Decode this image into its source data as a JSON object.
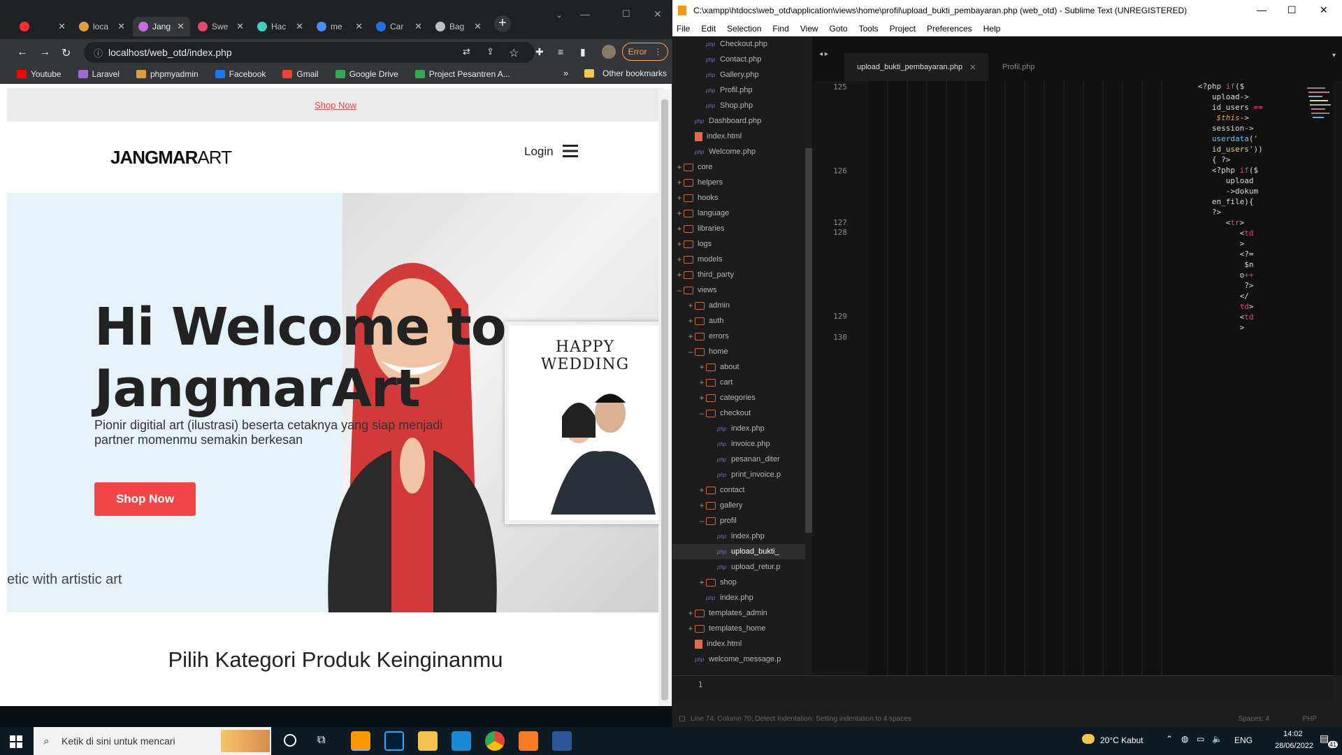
{
  "browser": {
    "tabs": [
      {
        "label": "",
        "color": "#ff2d2d"
      },
      {
        "label": "loca",
        "color": "#e09c3c"
      },
      {
        "label": "Jang",
        "color": "#c76ee0"
      },
      {
        "label": "Swe",
        "color": "#e44a6c"
      },
      {
        "label": "Hac",
        "color": "#3fd0c2"
      },
      {
        "label": "me",
        "color": "#4a8af4"
      },
      {
        "label": "Car",
        "color": "#1a73e8"
      },
      {
        "label": "Bag",
        "color": "#bdc1c6"
      }
    ],
    "url": "localhost/web_otd/index.php",
    "error_label": "Error",
    "bookmarks": [
      {
        "label": "Youtube",
        "color": "#ff0000"
      },
      {
        "label": "Laravel",
        "color": "#9b6bd6"
      },
      {
        "label": "phpmyadmin",
        "color": "#e09c3c"
      },
      {
        "label": "Facebook",
        "color": "#1877f2"
      },
      {
        "label": "Gmail",
        "color": "#ea4335"
      },
      {
        "label": "Google Drive",
        "color": "#34a853"
      },
      {
        "label": "Project Pesantren A...",
        "color": "#34a853"
      }
    ],
    "other_bookmarks": "Other bookmarks"
  },
  "site": {
    "top_link": "Shop Now",
    "logo_bold": "JANGMAR",
    "logo_light": "ART",
    "login": "Login",
    "hero_title": "Hi Welcome to JangmarArt",
    "hero_sub": "Pionir digitial art (ilustrasi) beserta cetaknya yang siap menjadi partner momenmu semakin berkesan",
    "shop_button": "Shop Now",
    "ticker": "etic with artistic art",
    "frame_title": "HAPPY WEDDING",
    "category_heading": "Pilih Kategori Produk Keinginanmu"
  },
  "sublime": {
    "title": "C:\\xampp\\htdocs\\web_otd\\application\\views\\home\\profil\\upload_bukti_pembayaran.php (web_otd) - Sublime Text (UNREGISTERED)",
    "menu": [
      "File",
      "Edit",
      "Selection",
      "Find",
      "View",
      "Goto",
      "Tools",
      "Project",
      "Preferences",
      "Help"
    ],
    "tabs": [
      "upload_bukti_pembayaran.php",
      "Profil.php"
    ],
    "sidebar": [
      {
        "label": "Checkout.php",
        "type": "php",
        "depth": 3
      },
      {
        "label": "Contact.php",
        "type": "php",
        "depth": 3
      },
      {
        "label": "Gallery.php",
        "type": "php",
        "depth": 3
      },
      {
        "label": "Profil.php",
        "type": "php",
        "depth": 3
      },
      {
        "label": "Shop.php",
        "type": "php",
        "depth": 3
      },
      {
        "label": "Dashboard.php",
        "type": "php",
        "depth": 2
      },
      {
        "label": "index.html",
        "type": "html",
        "depth": 2
      },
      {
        "label": "Welcome.php",
        "type": "php",
        "depth": 2
      },
      {
        "label": "core",
        "type": "folder",
        "depth": 1
      },
      {
        "label": "helpers",
        "type": "folder",
        "depth": 1
      },
      {
        "label": "hooks",
        "type": "folder",
        "depth": 1
      },
      {
        "label": "language",
        "type": "folder",
        "depth": 1
      },
      {
        "label": "libraries",
        "type": "folder",
        "depth": 1
      },
      {
        "label": "logs",
        "type": "folder",
        "depth": 1
      },
      {
        "label": "models",
        "type": "folder",
        "depth": 1
      },
      {
        "label": "third_party",
        "type": "folder",
        "depth": 1
      },
      {
        "label": "views",
        "type": "folder-open",
        "depth": 1
      },
      {
        "label": "admin",
        "type": "folder",
        "depth": 2
      },
      {
        "label": "auth",
        "type": "folder",
        "depth": 2
      },
      {
        "label": "errors",
        "type": "folder",
        "depth": 2
      },
      {
        "label": "home",
        "type": "folder-open",
        "depth": 2
      },
      {
        "label": "about",
        "type": "folder",
        "depth": 3
      },
      {
        "label": "cart",
        "type": "folder",
        "depth": 3
      },
      {
        "label": "categories",
        "type": "folder",
        "depth": 3
      },
      {
        "label": "checkout",
        "type": "folder-open",
        "depth": 3
      },
      {
        "label": "index.php",
        "type": "php",
        "depth": 4
      },
      {
        "label": "invoice.php",
        "type": "php",
        "depth": 4
      },
      {
        "label": "pesanan_diter",
        "type": "php",
        "depth": 4
      },
      {
        "label": "print_invoice.p",
        "type": "php",
        "depth": 4
      },
      {
        "label": "contact",
        "type": "folder",
        "depth": 3
      },
      {
        "label": "gallery",
        "type": "folder",
        "depth": 3
      },
      {
        "label": "profil",
        "type": "folder-open",
        "depth": 3
      },
      {
        "label": "index.php",
        "type": "php",
        "depth": 4
      },
      {
        "label": "upload_bukti_",
        "type": "php",
        "depth": 4,
        "selected": true
      },
      {
        "label": "upload_retur.p",
        "type": "php",
        "depth": 4
      },
      {
        "label": "shop",
        "type": "folder",
        "depth": 3
      },
      {
        "label": "index.php",
        "type": "php",
        "depth": 3
      },
      {
        "label": "templates_admin",
        "type": "folder",
        "depth": 2
      },
      {
        "label": "templates_home",
        "type": "folder",
        "depth": 2
      },
      {
        "label": "index.html",
        "type": "html",
        "depth": 2
      },
      {
        "label": "welcome_message.p",
        "type": "php",
        "depth": 2
      }
    ],
    "line_numbers": [
      "125",
      "126",
      "127",
      "128",
      "129",
      "130"
    ],
    "panel_line": "1",
    "status_left": "Line 74, Column 70; Detect Indentation: Setting indentation to 4 spaces",
    "status_spaces": "Spaces: 4",
    "status_syntax": "PHP"
  },
  "taskbar": {
    "search_placeholder": "Ketik di sini untuk mencari",
    "weather": "20°C  Kabut",
    "lang": "ENG",
    "time": "14:02",
    "date": "28/06/2022",
    "notif": "41"
  }
}
